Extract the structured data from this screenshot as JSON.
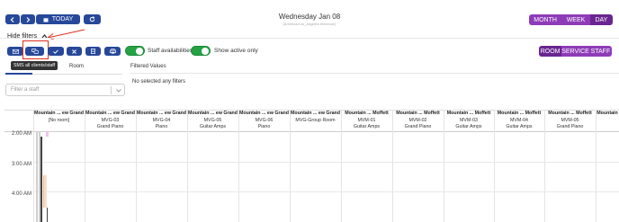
{
  "nav": {
    "today": "TODAY"
  },
  "header": {
    "date": "Wednesday Jan 08",
    "subtitle": "(America/Los_Angeles timezone)"
  },
  "views": {
    "month": "MONTH",
    "week": "WEEK",
    "day": "DAY"
  },
  "filters": {
    "hide_label": "Hide filters",
    "tooltip": "SMS all clients/staff",
    "staff_avail": "Staff availabilities",
    "show_active": "Show active only",
    "room_tab": "Room",
    "filtered_values_label": "Filtered Values",
    "no_filters": "No selected any filters",
    "staff_placeholder": "Filter a staff"
  },
  "modes": {
    "room": "ROOM",
    "service": "SERVICE",
    "staff": "STAFF"
  },
  "columns": [
    {
      "loc": "Mountain ... ew Grand",
      "name": "[No room]",
      "type": ""
    },
    {
      "loc": "Mountain ... ew Grand",
      "name": "MVG-03",
      "type": "Grand Piano"
    },
    {
      "loc": "Mountain ... ew Grand",
      "name": "MVG-04",
      "type": "Piano"
    },
    {
      "loc": "Mountain ... ew Grand",
      "name": "MVG-05",
      "type": "Guitar Amps"
    },
    {
      "loc": "Mountain ... ew Grand",
      "name": "MVG-06",
      "type": "Piano"
    },
    {
      "loc": "Mountain ... ew Grand",
      "name": "MVG-Group Room",
      "type": ""
    },
    {
      "loc": "Mountain ... Moffett",
      "name": "MVM-01",
      "type": "Guitar Amps"
    },
    {
      "loc": "Mountain ... Moffett",
      "name": "MVM-02",
      "type": "Grand Piano"
    },
    {
      "loc": "Mountain ... Moffett",
      "name": "MVM-03",
      "type": "Guitar Amps"
    },
    {
      "loc": "Mountain ... Moffett",
      "name": "MVM-04",
      "type": "Guitar Amps"
    },
    {
      "loc": "Mountain ... Moffett",
      "name": "MVM-05",
      "type": "Grand Piano"
    },
    {
      "loc": "Mountain",
      "name": "",
      "type": ""
    }
  ],
  "times": [
    "2:00 AM",
    "3:00 AM",
    "4:00 AM"
  ],
  "icons": {
    "prev": "chevron-left-icon",
    "next": "chevron-right-icon",
    "calendar": "calendar-icon",
    "refresh": "refresh-icon",
    "email": "email-icon",
    "sms": "sms-icon",
    "check": "check-icon",
    "close": "close-icon",
    "edit": "edit-icon",
    "print": "print-icon",
    "chevron": "chevron-down-icon",
    "arrow": "annotation-arrow"
  }
}
